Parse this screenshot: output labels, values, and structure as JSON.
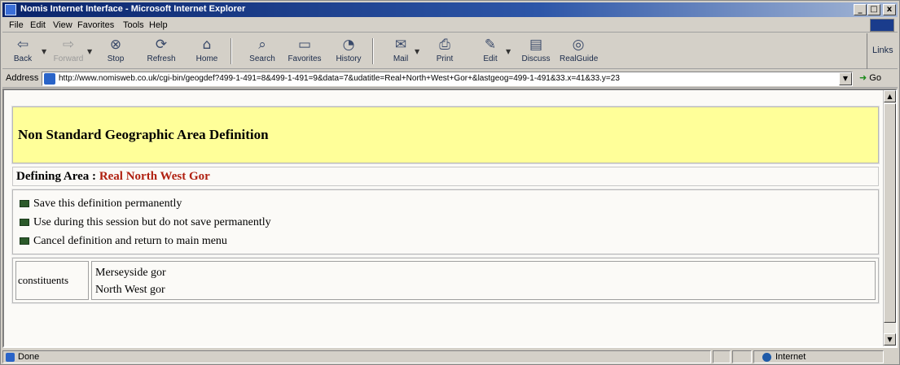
{
  "window": {
    "title": "Nomis Internet Interface - Microsoft Internet Explorer",
    "controls": [
      "_",
      "□",
      "x"
    ]
  },
  "menu": {
    "items": [
      "File",
      "Edit",
      "View",
      "Favorites",
      "Tools",
      "Help"
    ]
  },
  "toolbar": {
    "back": "Back",
    "forward": "Forward",
    "stop": "Stop",
    "refresh": "Refresh",
    "home": "Home",
    "search": "Search",
    "favorites": "Favorites",
    "history": "History",
    "mail": "Mail",
    "print": "Print",
    "edit": "Edit",
    "discuss": "Discuss",
    "realguide": "RealGuide",
    "links": "Links"
  },
  "address": {
    "label": "Address",
    "url": "http://www.nomisweb.co.uk/cgi-bin/geogdef?499-1-491=8&499-1-491=9&data=7&udatitle=Real+North+West+Gor+&lastgeog=499-1-491&33.x=41&33.y=23",
    "go": "Go"
  },
  "page": {
    "heading": "Non Standard Geographic Area Definition",
    "defining_label": "Defining Area :",
    "defining_value": "Real North West Gor",
    "options": [
      "Save this definition permanently",
      "Use during this session but do not save permanently",
      "Cancel definition and return to main menu"
    ],
    "constituents_label": "constituents",
    "constituents": [
      "Merseyside gor",
      "North West gor"
    ]
  },
  "status": {
    "text": "Done",
    "zone": "Internet"
  }
}
